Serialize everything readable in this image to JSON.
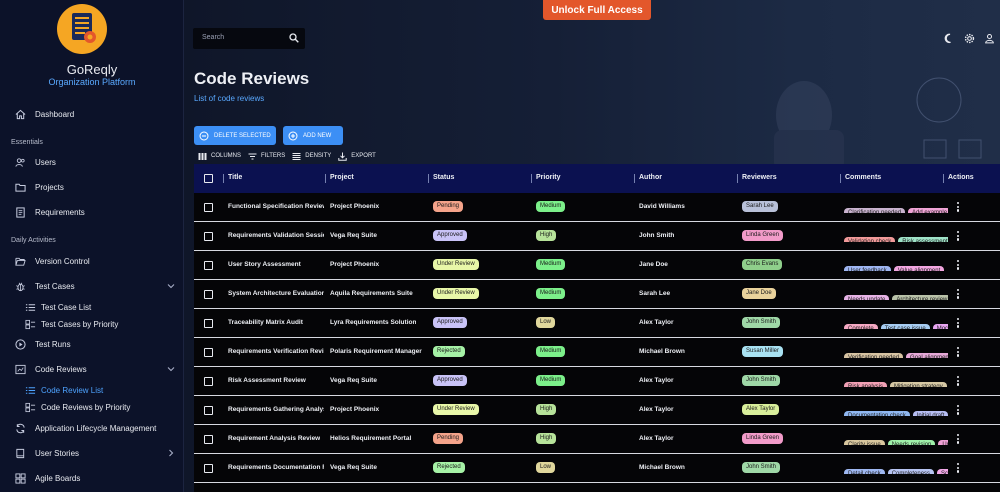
{
  "banner": {
    "label": "Unlock Full Access"
  },
  "sidebar": {
    "org_name": "GoReqly",
    "org_subtitle": "Organization Platform",
    "sections": {
      "essentials": "Essentials",
      "daily": "Daily Activities"
    },
    "items": {
      "dashboard": "Dashboard",
      "users": "Users",
      "projects": "Projects",
      "requirements": "Requirements",
      "version_control": "Version Control",
      "test_cases": "Test Cases",
      "test_case_list": "Test Case List",
      "test_cases_priority": "Test Cases by Priority",
      "test_runs": "Test Runs",
      "code_reviews": "Code Reviews",
      "code_review_list": "Code Review List",
      "code_reviews_priority": "Code Reviews by Priority",
      "alm": "Application Lifecycle Management",
      "user_stories": "User Stories",
      "agile_boards": "Agile Boards"
    }
  },
  "search": {
    "placeholder": "Search"
  },
  "page": {
    "title": "Code Reviews",
    "subtitle": "List of code reviews"
  },
  "actions": {
    "delete": "DELETE SELECTED",
    "add": "ADD NEW"
  },
  "toolbar": {
    "columns": "COLUMNS",
    "filters": "FILTERS",
    "density": "DENSITY",
    "export": "EXPORT"
  },
  "columns": {
    "title": "Title",
    "project": "Project",
    "status": "Status",
    "priority": "Priority",
    "author": "Author",
    "reviewers": "Reviewers",
    "comments": "Comments",
    "actions": "Actions"
  },
  "colors": {
    "accent": "#3c8ff5",
    "status": {
      "Pending": "#f4a38a",
      "Approved": "#c9c3f7",
      "Under Review": "#e8f7a8",
      "Rejected": "#a6f2a6"
    },
    "priority": {
      "Medium": "#7cf08a",
      "High": "#b7e39a",
      "Low": "#e0d79c"
    },
    "reviewer": {
      "Sarah Lee": "#b8c0d8",
      "Linda Green": "#f29bc9",
      "Chris Evans": "#8fcf8b",
      "Jane Doe": "#ead39c",
      "John Smith": "#9fd8a7",
      "Susan Miller": "#a9e2f2",
      "Alex Taylor": "#d9ef9b"
    }
  },
  "rows": [
    {
      "title": "Functional Specification Review",
      "project": "Project Phoenix",
      "status": "Pending",
      "priority": "Medium",
      "author": "David Williams",
      "reviewer": "Sarah Lee",
      "comments": [
        {
          "text": "Clarification needed",
          "color": "#c9b3cf"
        },
        {
          "text": "Add example",
          "color": "#f0a4d6"
        }
      ]
    },
    {
      "title": "Requirements Validation Session",
      "project": "Vega Req Suite",
      "status": "Approved",
      "priority": "High",
      "author": "John Smith",
      "reviewer": "Linda Green",
      "comments": [
        {
          "text": "Validation check",
          "color": "#f29a9a"
        },
        {
          "text": "Risk assessment",
          "color": "#9fe3c8"
        }
      ]
    },
    {
      "title": "User Story Assessment",
      "project": "Project Phoenix",
      "status": "Under Review",
      "priority": "Medium",
      "author": "Jane Doe",
      "reviewer": "Chris Evans",
      "comments": [
        {
          "text": "User feedback",
          "color": "#9fb6f2"
        },
        {
          "text": "Value alignment",
          "color": "#f2a6e0"
        }
      ]
    },
    {
      "title": "System Architecture Evaluation",
      "project": "Aquila Requirements Suite",
      "status": "Under Review",
      "priority": "Medium",
      "author": "Sarah Lee",
      "reviewer": "Jane Doe",
      "comments": [
        {
          "text": "Needs update",
          "color": "#e7b3e6"
        },
        {
          "text": "Architecture review",
          "color": "#b9c2a8"
        }
      ]
    },
    {
      "title": "Traceability Matrix Audit",
      "project": "Lyra Requirements Solution",
      "status": "Approved",
      "priority": "Low",
      "author": "Alex Taylor",
      "reviewer": "John Smith",
      "comments": [
        {
          "text": "Complete",
          "color": "#f6a9c3"
        },
        {
          "text": "Test case issue",
          "color": "#a7cdf2"
        },
        {
          "text": "Mock",
          "color": "#e9a6f2"
        }
      ]
    },
    {
      "title": "Requirements Verification Review",
      "project": "Polaris Requirement Manager",
      "status": "Rejected",
      "priority": "Medium",
      "author": "Michael Brown",
      "reviewer": "Susan Miller",
      "comments": [
        {
          "text": "Verification needed",
          "color": "#d7c3a2"
        },
        {
          "text": "Goal alignment",
          "color": "#e7a9d8"
        }
      ]
    },
    {
      "title": "Risk Assessment Review",
      "project": "Vega Req Suite",
      "status": "Approved",
      "priority": "Medium",
      "author": "Alex Taylor",
      "reviewer": "John Smith",
      "comments": [
        {
          "text": "Risk analysis",
          "color": "#f2a0b5"
        },
        {
          "text": "Mitigation strategy",
          "color": "#d6c8a4"
        }
      ]
    },
    {
      "title": "Requirements Gathering Analysis",
      "project": "Project Phoenix",
      "status": "Under Review",
      "priority": "High",
      "author": "Alex Taylor",
      "reviewer": "Alex Taylor",
      "comments": [
        {
          "text": "Documentation check",
          "color": "#8fb7f0"
        },
        {
          "text": "Initial draft",
          "color": "#b6bdf2"
        }
      ]
    },
    {
      "title": "Requirement Analysis Review",
      "project": "Helios Requirement Portal",
      "status": "Pending",
      "priority": "High",
      "author": "Alex Taylor",
      "reviewer": "Linda Green",
      "comments": [
        {
          "text": "Clarity issue",
          "color": "#d9c79e"
        },
        {
          "text": "Needs revision",
          "color": "#9ff0a9"
        },
        {
          "text": "Update",
          "color": "#f0a0d6"
        }
      ]
    },
    {
      "title": "Requirements Documentation Review",
      "project": "Vega Req Suite",
      "status": "Rejected",
      "priority": "Low",
      "author": "Michael Brown",
      "reviewer": "John Smith",
      "comments": [
        {
          "text": "Detail check",
          "color": "#9fb8f2"
        },
        {
          "text": "Completeness",
          "color": "#b7c4f2"
        },
        {
          "text": "Scope",
          "color": "#f1a8e7"
        }
      ]
    }
  ]
}
